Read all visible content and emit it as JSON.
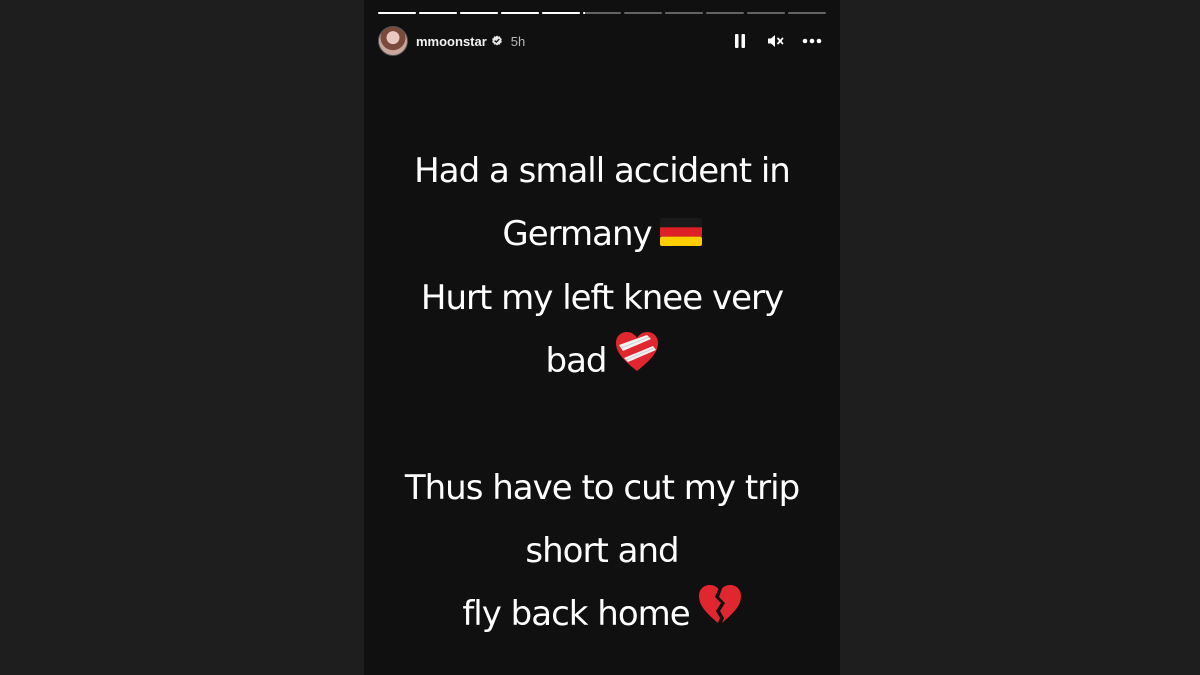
{
  "story": {
    "progress_segments": [
      1,
      1,
      1,
      1,
      1,
      0.05,
      0,
      0,
      0,
      0,
      0
    ],
    "username": "mmoonstar",
    "timestamp": "5h",
    "lines": {
      "l1": "Had a small accident in",
      "l2": "Germany",
      "l3": "Hurt my left knee very",
      "l4": "bad",
      "l5": "Thus have to cut my trip",
      "l6": "short and",
      "l7": "fly  back home"
    },
    "emojis": {
      "flag": "germany-flag-icon",
      "bandaged_heart": "mending-heart-icon",
      "broken_heart": "broken-heart-icon"
    }
  },
  "colors": {
    "background": "#1e1e1e",
    "story_background": "#101010",
    "text": "#ffffff",
    "muted_text": "#b8b8b8",
    "heart_red": "#e0262f"
  }
}
